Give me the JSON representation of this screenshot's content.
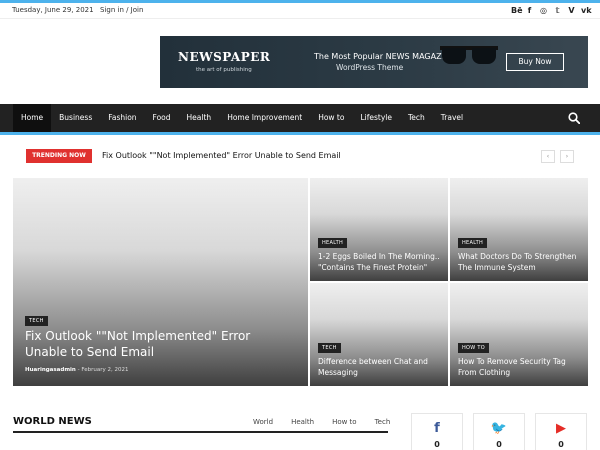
{
  "topbar": {
    "date": "Tuesday, June 29, 2021",
    "signin": "Sign in / Join",
    "socials": [
      "Bē",
      "f",
      "◎",
      "𝕥",
      "V",
      "vk"
    ]
  },
  "banner": {
    "brand": "NEWSPAPER",
    "brand_sub": "the art of publishing",
    "tagline_1": "The Most Popular NEWS MAGAZINE",
    "tagline_2": "WordPress Theme",
    "buy_label": "Buy Now"
  },
  "nav": {
    "items": [
      "Home",
      "Business",
      "Fashion",
      "Food",
      "Health",
      "Home Improvement",
      "How to",
      "Lifestyle",
      "Tech",
      "Travel"
    ],
    "active": "Home"
  },
  "trending": {
    "label": "TRENDING NOW",
    "title": "Fix Outlook \"\"Not Implemented\" Error Unable to Send Email",
    "prev": "‹",
    "next": "›"
  },
  "featured": {
    "big": {
      "category": "TECH",
      "title": "Fix Outlook \"\"Not Implemented\" Error Unable to Send Email",
      "author": "Huaringasadmin",
      "date": "- February 2, 2021"
    },
    "small": [
      {
        "category": "HEALTH",
        "title": "1-2 Eggs Boiled In The Morning.. \"Contains The Finest Protein\""
      },
      {
        "category": "HEALTH",
        "title": "What Doctors Do To Strengthen The Immune System"
      },
      {
        "category": "TECH",
        "title": "Difference between Chat and Messaging"
      },
      {
        "category": "HOW TO",
        "title": "How To Remove Security Tag From Clothing"
      }
    ]
  },
  "world_news": {
    "title": "WORLD NEWS",
    "tabs": [
      "World",
      "Health",
      "How to",
      "Tech"
    ]
  },
  "social_counts": [
    {
      "icon": "f",
      "color": "#3b5998",
      "count": "0"
    },
    {
      "icon": "🐦",
      "color": "#1da1f2",
      "count": "0"
    },
    {
      "icon": "▶",
      "color": "#e52d27",
      "count": "0"
    }
  ]
}
